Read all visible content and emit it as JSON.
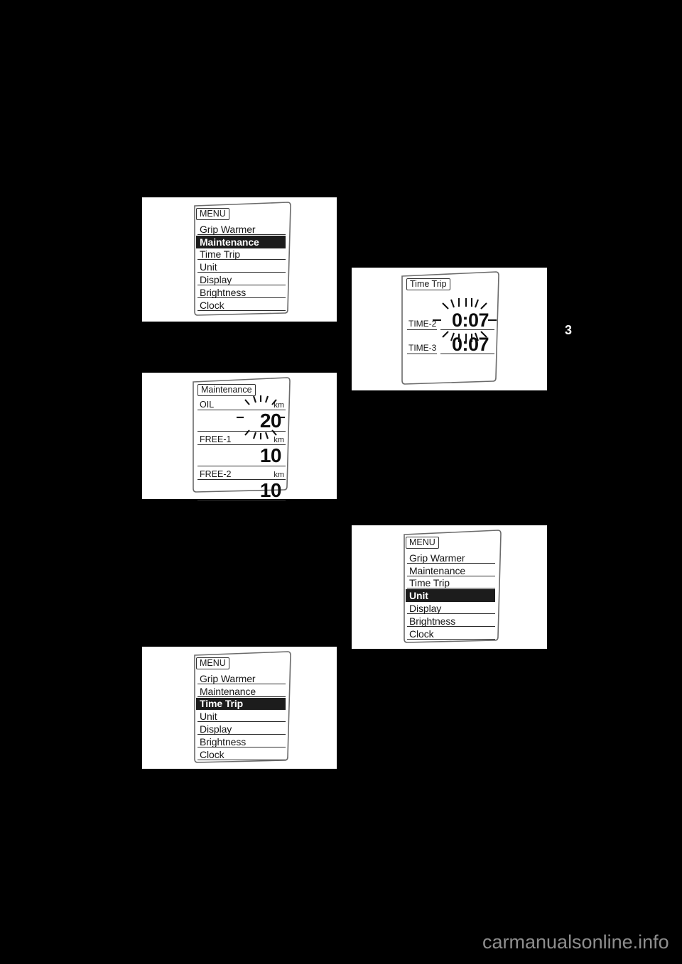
{
  "page": {
    "background_color": "#000000",
    "chapter_tab": "3",
    "watermark": "carmanualsonline.info"
  },
  "figures": [
    {
      "id": "menu-maintenance",
      "kind": "menu",
      "header": "MENU",
      "items": [
        {
          "label": "Grip Warmer",
          "selected": false
        },
        {
          "label": "Maintenance",
          "selected": true
        },
        {
          "label": "Time Trip",
          "selected": false
        },
        {
          "label": "Unit",
          "selected": false
        },
        {
          "label": "Display",
          "selected": false
        },
        {
          "label": "Brightness",
          "selected": false
        },
        {
          "label": "Clock",
          "selected": false
        }
      ]
    },
    {
      "id": "maintenance-screen",
      "kind": "values",
      "header": "Maintenance",
      "rows": [
        {
          "label": "OIL",
          "unit": "km",
          "value": "20",
          "flashing": true
        },
        {
          "label": "FREE-1",
          "unit": "km",
          "value": "10",
          "flashing": false
        },
        {
          "label": "FREE-2",
          "unit": "km",
          "value": "10",
          "flashing": false
        }
      ]
    },
    {
      "id": "menu-time-trip",
      "kind": "menu",
      "header": "MENU",
      "items": [
        {
          "label": "Grip Warmer",
          "selected": false
        },
        {
          "label": "Maintenance",
          "selected": false
        },
        {
          "label": "Time Trip",
          "selected": true
        },
        {
          "label": "Unit",
          "selected": false
        },
        {
          "label": "Display",
          "selected": false
        },
        {
          "label": "Brightness",
          "selected": false
        },
        {
          "label": "Clock",
          "selected": false
        }
      ]
    },
    {
      "id": "time-trip-screen",
      "kind": "timetrip",
      "header": "Time Trip",
      "rows": [
        {
          "label": "TIME-2",
          "value": "0:07",
          "flashing": true
        },
        {
          "label": "TIME-3",
          "value": "0:07",
          "flashing": false
        }
      ]
    },
    {
      "id": "menu-unit",
      "kind": "menu",
      "header": "MENU",
      "items": [
        {
          "label": "Grip Warmer",
          "selected": false
        },
        {
          "label": "Maintenance",
          "selected": false
        },
        {
          "label": "Time Trip",
          "selected": false
        },
        {
          "label": "Unit",
          "selected": true
        },
        {
          "label": "Display",
          "selected": false
        },
        {
          "label": "Brightness",
          "selected": false
        },
        {
          "label": "Clock",
          "selected": false
        }
      ]
    }
  ]
}
